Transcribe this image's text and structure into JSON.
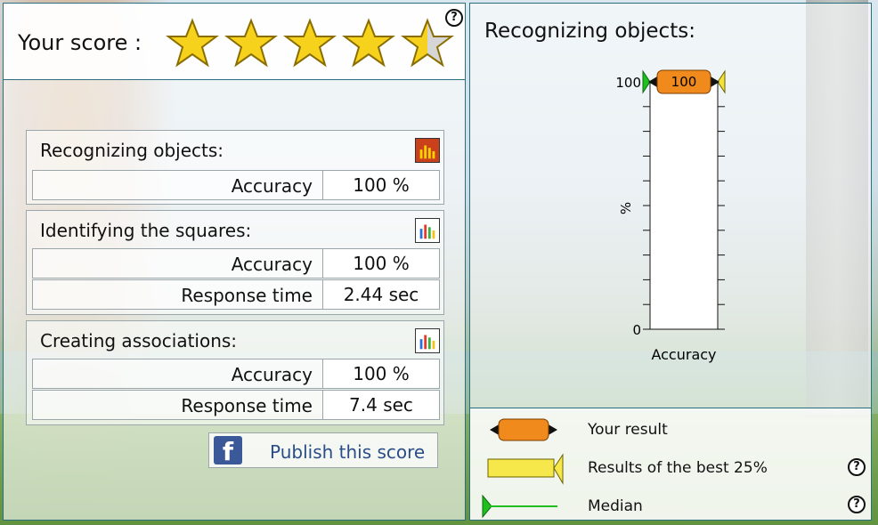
{
  "score": {
    "label": "Your score :",
    "stars_filled": 4.5,
    "stars_total": 5
  },
  "groups": [
    {
      "title": "Recognizing objects:",
      "metrics": [
        {
          "label": "Accuracy",
          "value": "100 %"
        }
      ]
    },
    {
      "title": "Identifying the squares:",
      "metrics": [
        {
          "label": "Accuracy",
          "value": "100 %"
        },
        {
          "label": "Response time",
          "value": "2.44 sec"
        }
      ]
    },
    {
      "title": "Creating associations:",
      "metrics": [
        {
          "label": "Accuracy",
          "value": "100 %"
        },
        {
          "label": "Response time",
          "value": "7.4 sec"
        }
      ]
    }
  ],
  "publish": {
    "label": "Publish this score",
    "icon": "facebook-icon"
  },
  "right": {
    "title": "Recognizing objects:"
  },
  "chart_data": {
    "type": "bar",
    "categories": [
      "Accuracy"
    ],
    "ylabel": "%",
    "ylim": [
      0,
      100
    ],
    "tick_labels": [
      "0",
      "100"
    ],
    "your_result": 100,
    "your_result_label": "100",
    "median": 100,
    "best_25_range": [
      100,
      100
    ]
  },
  "legend": {
    "your_result": "Your result",
    "best": "Results of the best 25%",
    "median": "Median"
  },
  "colors": {
    "panel_border": "#2a6f7d",
    "result_orange": "#f08a1c",
    "best_yellow": "#f3e23a",
    "median_green": "#1fbf1f"
  }
}
